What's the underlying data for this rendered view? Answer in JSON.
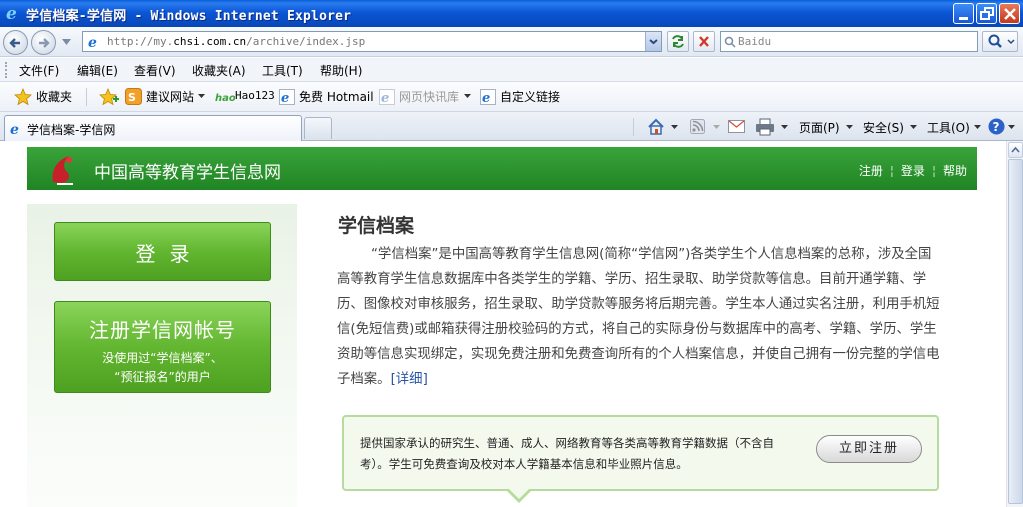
{
  "window": {
    "title": "学信档案-学信网 - Windows Internet Explorer"
  },
  "address_bar": {
    "url_prefix": "http://my.",
    "url_domain": "chsi.com.cn",
    "url_path": "/archive/index.jsp",
    "search_placeholder": "Baidu"
  },
  "menu": {
    "items": [
      "文件(F)",
      "编辑(E)",
      "查看(V)",
      "收藏夹(A)",
      "工具(T)",
      "帮助(H)"
    ]
  },
  "favorites": {
    "favorites_label": "收藏夹",
    "suggested_sites": "建议网站",
    "hao123": "Hao123",
    "hotmail": "免费 Hotmail",
    "web_slice": "网页快讯库",
    "custom_links": "自定义链接"
  },
  "tabs": {
    "active_tab": "学信档案-学信网"
  },
  "command_bar": {
    "page": "页面(P)",
    "safety": "安全(S)",
    "tools": "工具(O)"
  },
  "site": {
    "name": "中国高等教育学生信息网",
    "links": {
      "register": "注册",
      "login": "登录",
      "help": "帮助"
    }
  },
  "sidebar": {
    "login_button": "登录",
    "register_button": "注册学信网帐号",
    "register_note_line1": "没使用过“学信档案”、",
    "register_note_line2": "“预征报名”的用户"
  },
  "main": {
    "title": "学信档案",
    "description": "“学信档案”是中国高等教育学生信息网(简称“学信网”)各类学生个人信息档案的总称，涉及全国高等教育学生信息数据库中各类学生的学籍、学历、招生录取、助学贷款等信息。目前开通学籍、学历、图像校对审核服务，招生录取、助学贷款等服务将后期完善。学生本人通过实名注册，利用手机短信(免短信费)或邮箱获得注册校验码的方式，将自己的实际身份与数据库中的高考、学籍、学历、学生资助等信息实现绑定，实现免费注册和免费查询所有的个人档案信息，并使自己拥有一份完整的学信电子档案。",
    "more_link": "[详细]"
  },
  "infobox": {
    "text": "提供国家承认的研究生、普通、成人、网络教育等各类高等教育学籍数据（不含自考）。学生可免费查询及校对本人学籍基本信息和毕业照片信息。",
    "button": "立即注册"
  },
  "colors": {
    "titlebar_blue": "#0b57d6",
    "site_green": "#2a942e",
    "button_green": "#62b630",
    "link_blue": "#2a55a5"
  }
}
